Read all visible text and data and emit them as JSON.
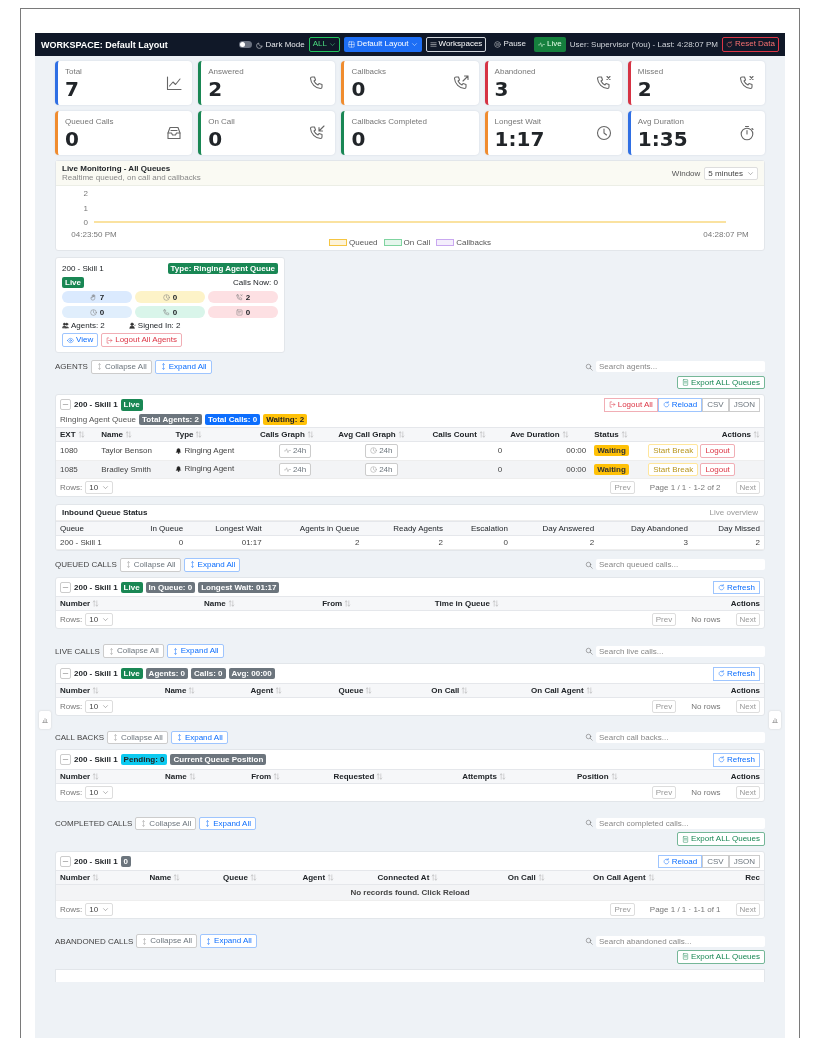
{
  "topbar": {
    "title": "WORKSPACE: Default Layout",
    "dark_mode": {
      "label": "Dark Mode",
      "on": false
    },
    "queue_filter": "ALL",
    "layout_button": "Default Layout",
    "workspaces_button": "Workspaces",
    "pause_button": "Pause",
    "live_button": "Live",
    "user_info": "User: Supervisor (You) - Last: 4:28:07 PM",
    "reset_button": "Reset Data"
  },
  "stats": [
    {
      "label": "Total",
      "value": "7",
      "color": "#2f6fe4",
      "kind": "chart"
    },
    {
      "label": "Answered",
      "value": "2",
      "color": "#198754",
      "kind": "phone"
    },
    {
      "label": "Callbacks",
      "value": "0",
      "color": "#f08c2e",
      "kind": "outgoing"
    },
    {
      "label": "Abandoned",
      "value": "3",
      "color": "#d63344",
      "kind": "failed"
    },
    {
      "label": "Missed",
      "value": "2",
      "color": "#d63344",
      "kind": "failed"
    },
    {
      "label": "Queued Calls",
      "value": "0",
      "color": "#f08c2e",
      "kind": "inbox"
    },
    {
      "label": "On Call",
      "value": "0",
      "color": "#198754",
      "kind": "incoming"
    },
    {
      "label": "Callbacks Completed",
      "value": "0",
      "color": "#198754",
      "kind": "plain"
    },
    {
      "label": "Longest Wait",
      "value": "1:17",
      "color": "#f08c2e",
      "kind": "clock"
    },
    {
      "label": "Avg Duration",
      "value": "1:35",
      "color": "#2f6fe4",
      "kind": "stopwatch"
    }
  ],
  "live_monitoring": {
    "title": "Live Monitoring - All Queues",
    "subtitle": "Realtime queued, on call and callbacks",
    "window_label": "Window",
    "window_value": "5 minutes",
    "chart_data": {
      "type": "line",
      "x": [
        "04:23:50 PM",
        "04:28:07 PM"
      ],
      "ylim": [
        0,
        2
      ],
      "yticks": [
        0,
        1,
        2
      ],
      "legend": "bottom",
      "series": [
        {
          "name": "Queued",
          "color": "#f5c542",
          "values": [
            0,
            0
          ]
        },
        {
          "name": "On Call",
          "color": "#7fd4a0",
          "values": [
            null,
            null
          ]
        },
        {
          "name": "Callbacks",
          "color": "#c9a8f0",
          "values": [
            null,
            null
          ]
        }
      ]
    }
  },
  "queue_card": {
    "name": "200 - Skill 1",
    "type_badge": "Type: Ringing Agent Queue",
    "status": "Live",
    "calls_now": "Calls Now: 0",
    "pills": [
      {
        "kind": "hand",
        "value": "7",
        "color": "#dbeafe"
      },
      {
        "kind": "clock",
        "value": "0",
        "color": "#fdf3c8"
      },
      {
        "kind": "failed",
        "value": "2",
        "color": "#fde0e3"
      },
      {
        "kind": "clock",
        "value": "0",
        "color": "#e0eefc"
      },
      {
        "kind": "phone",
        "value": "0",
        "color": "#d9f5ea"
      },
      {
        "kind": "voicemail",
        "value": "0",
        "color": "#fde0e3"
      }
    ],
    "agents": "Agents: 2",
    "signed_in": "Signed In: 2",
    "view_button": "View",
    "logout_button": "Logout All Agents"
  },
  "agents": {
    "heading": "AGENTS",
    "collapse": "Collapse All",
    "expand": "Expand All",
    "search_placeholder": "Search agents...",
    "export": "Export ALL Queues",
    "panel": {
      "title": "200 - Skill 1",
      "badges": [
        {
          "text": "Live",
          "color": "#198754"
        }
      ],
      "subtitle": "Ringing Agent Queue",
      "sub_badges": [
        {
          "text": "Total Agents: 2",
          "color": "#6c757d"
        },
        {
          "text": "Total Calls: 0",
          "color": "#0d6efd"
        },
        {
          "text": "Waiting: 2",
          "color": "#ffc107"
        }
      ],
      "actions": [
        {
          "label": "Logout All",
          "kind": "danger"
        },
        {
          "label": "Reload",
          "kind": "primary"
        },
        {
          "label": "CSV",
          "kind": "plain"
        },
        {
          "label": "JSON",
          "kind": "plain"
        }
      ],
      "columns": [
        {
          "label": "EXT",
          "sortable": true
        },
        {
          "label": "Name",
          "sortable": true
        },
        {
          "label": "Type",
          "sortable": true
        },
        {
          "label": "Calls Graph",
          "sortable": true
        },
        {
          "label": "Avg Call Graph",
          "sortable": true
        },
        {
          "label": "Calls Count",
          "sortable": true
        },
        {
          "label": "Ave Duration",
          "sortable": true
        },
        {
          "label": "Status",
          "sortable": true
        },
        {
          "label": "Actions",
          "sortable": true
        }
      ],
      "rows": [
        {
          "ext": "1080",
          "name": "Taylor Benson",
          "type": "Ringing Agent",
          "calls_graph": "24h",
          "avg_graph": "24h",
          "count": "0",
          "duration": "00:00",
          "status": "Waiting",
          "break_button": "Start Break",
          "logout_button": "Logout"
        },
        {
          "ext": "1085",
          "name": "Bradley Smith",
          "type": "Ringing Agent",
          "calls_graph": "24h",
          "avg_graph": "24h",
          "count": "0",
          "duration": "00:00",
          "status": "Waiting",
          "break_button": "Start Break",
          "logout_button": "Logout"
        }
      ],
      "footer": {
        "rows_label": "Rows:",
        "page_size": "10",
        "prev": "Prev",
        "page_info": "Page 1 / 1 · 1-2 of 2",
        "next": "Next"
      }
    }
  },
  "inbound_status": {
    "title": "Inbound Queue Status",
    "note": "Live overview",
    "columns": [
      "Queue",
      "In Queue",
      "Longest Wait",
      "Agents in Queue",
      "Ready Agents",
      "Escalation",
      "Day Answered",
      "Day Abandoned",
      "Day Missed"
    ],
    "rows": [
      [
        "200 - Skill 1",
        "0",
        "01:17",
        "2",
        "2",
        "0",
        "2",
        "3",
        "2"
      ]
    ]
  },
  "call_sections": [
    {
      "heading": "QUEUED CALLS",
      "collapse": "Collapse All",
      "expand": "Expand All",
      "search_placeholder": "Search queued calls...",
      "panel": {
        "title": "200 - Skill 1",
        "badges": [
          {
            "text": "Live",
            "color": "#198754"
          },
          {
            "text": "In Queue: 0",
            "color": "#6c757d"
          },
          {
            "text": "Longest Wait: 01:17",
            "color": "#6c757d"
          }
        ],
        "actions": [
          {
            "label": "Refresh",
            "kind": "primary"
          }
        ],
        "columns": [
          {
            "label": "Number",
            "sortable": true
          },
          {
            "label": "Name",
            "sortable": true
          },
          {
            "label": "From",
            "sortable": true
          },
          {
            "label": "Time in Queue",
            "sortable": true
          },
          {
            "label": "Actions",
            "sortable": false
          }
        ],
        "footer": {
          "rows_label": "Rows:",
          "page_size": "10",
          "prev": "Prev",
          "page_info": "No rows",
          "next": "Next"
        }
      }
    },
    {
      "heading": "LIVE CALLS",
      "collapse": "Collapse All",
      "expand": "Expand All",
      "search_placeholder": "Search live calls...",
      "panel": {
        "title": "200 - Skill 1",
        "badges": [
          {
            "text": "Live",
            "color": "#198754"
          },
          {
            "text": "Agents: 0",
            "color": "#6c757d"
          },
          {
            "text": "Calls: 0",
            "color": "#6c757d"
          },
          {
            "text": "Avg: 00:00",
            "color": "#6c757d"
          }
        ],
        "actions": [
          {
            "label": "Refresh",
            "kind": "primary"
          }
        ],
        "columns": [
          {
            "label": "Number",
            "sortable": true
          },
          {
            "label": "Name",
            "sortable": true
          },
          {
            "label": "Agent",
            "sortable": true
          },
          {
            "label": "Queue",
            "sortable": true
          },
          {
            "label": "On Call",
            "sortable": true
          },
          {
            "label": "On Call Agent",
            "sortable": true
          },
          {
            "label": "Actions",
            "sortable": false
          }
        ],
        "footer": {
          "rows_label": "Rows:",
          "page_size": "10",
          "prev": "Prev",
          "page_info": "No rows",
          "next": "Next"
        }
      }
    },
    {
      "heading": "CALL BACKS",
      "collapse": "Collapse All",
      "expand": "Expand All",
      "search_placeholder": "Search call backs...",
      "panel": {
        "title": "200 - Skill 1",
        "badges": [
          {
            "text": "Pending: 0",
            "color": "#0dcaf0"
          },
          {
            "text": "Current Queue Position",
            "color": "#6c757d"
          }
        ],
        "actions": [
          {
            "label": "Refresh",
            "kind": "primary"
          }
        ],
        "columns": [
          {
            "label": "Number",
            "sortable": true
          },
          {
            "label": "Name",
            "sortable": true
          },
          {
            "label": "From",
            "sortable": true
          },
          {
            "label": "Requested",
            "sortable": true
          },
          {
            "label": "Attempts",
            "sortable": true
          },
          {
            "label": "Position",
            "sortable": true
          },
          {
            "label": "Actions",
            "sortable": false
          }
        ],
        "footer": {
          "rows_label": "Rows:",
          "page_size": "10",
          "prev": "Prev",
          "page_info": "No rows",
          "next": "Next"
        }
      }
    },
    {
      "heading": "COMPLETED CALLS",
      "collapse": "Collapse All",
      "expand": "Expand All",
      "search_placeholder": "Search completed calls...",
      "export": "Export ALL Queues",
      "panel": {
        "title": "200 - Skill 1",
        "badges": [
          {
            "text": "0",
            "color": "#6c757d"
          }
        ],
        "actions": [
          {
            "label": "Reload",
            "kind": "primary"
          },
          {
            "label": "CSV",
            "kind": "plain"
          },
          {
            "label": "JSON",
            "kind": "plain"
          }
        ],
        "columns": [
          {
            "label": "Number",
            "sortable": true
          },
          {
            "label": "Name",
            "sortable": true
          },
          {
            "label": "Queue",
            "sortable": true
          },
          {
            "label": "Agent",
            "sortable": true
          },
          {
            "label": "Connected At",
            "sortable": true
          },
          {
            "label": "On Call",
            "sortable": true
          },
          {
            "label": "On Call Agent",
            "sortable": true
          },
          {
            "label": "Rec",
            "sortable": false
          }
        ],
        "empty_message": "No records found. Click Reload",
        "footer": {
          "rows_label": "Rows:",
          "page_size": "10",
          "prev": "Prev",
          "page_info": "Page 1 / 1 · 1-1 of 1",
          "next": "Next"
        }
      }
    },
    {
      "heading": "ABANDONED CALLS",
      "collapse": "Collapse All",
      "expand": "Expand All",
      "search_placeholder": "Search abandoned calls...",
      "export": "Export ALL Queues"
    }
  ]
}
